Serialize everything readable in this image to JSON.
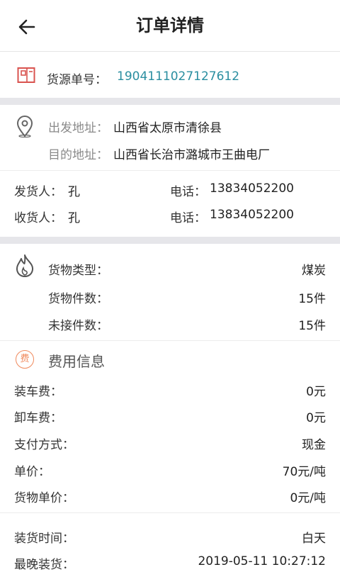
{
  "header": {
    "title": "订单详情",
    "back_icon": "arrow-left-icon"
  },
  "source": {
    "label": "货源单号：",
    "number": "1904111027127612",
    "icon": "package-icon"
  },
  "address": {
    "icon": "location-pin-icon",
    "origin_label": "出发地址：",
    "origin": "山西省太原市清徐县",
    "dest_label": "目的地址：",
    "dest": "山西省长治市潞城市王曲电厂"
  },
  "contacts": {
    "sender_label": "发货人：",
    "sender": "孔",
    "sender_phone_label": "电话：",
    "sender_phone": "13834052200",
    "receiver_label": "收货人：",
    "receiver": "孔",
    "receiver_phone_label": "电话：",
    "receiver_phone": "13834052200"
  },
  "cargo": {
    "icon": "flame-icon",
    "type_label": "货物类型：",
    "type": "煤炭",
    "count_label": "货物件数：",
    "count": "15件",
    "unclaimed_label": "未接件数：",
    "unclaimed": "15件"
  },
  "fees": {
    "icon": "fee-badge-icon",
    "icon_char": "费",
    "title": "费用信息",
    "loading_label": "装车费：",
    "loading": "0元",
    "unloading_label": "卸车费：",
    "unloading": "0元",
    "payment_label": "支付方式：",
    "payment": "现金",
    "unit_price_label": "单价：",
    "unit_price": "70元/吨",
    "cargo_price_label": "货物单价：",
    "cargo_price": "0元/吨"
  },
  "times": {
    "load_time_label": "装货时间：",
    "load_time": "白天",
    "latest_label": "最晚装货：",
    "latest": "2019-05-11 10:27:12"
  },
  "colors": {
    "accent_blue": "#2a8ea0",
    "fee_orange": "#f08a5d",
    "icon_red": "#d9534f",
    "separator": "#e6e6ea"
  }
}
